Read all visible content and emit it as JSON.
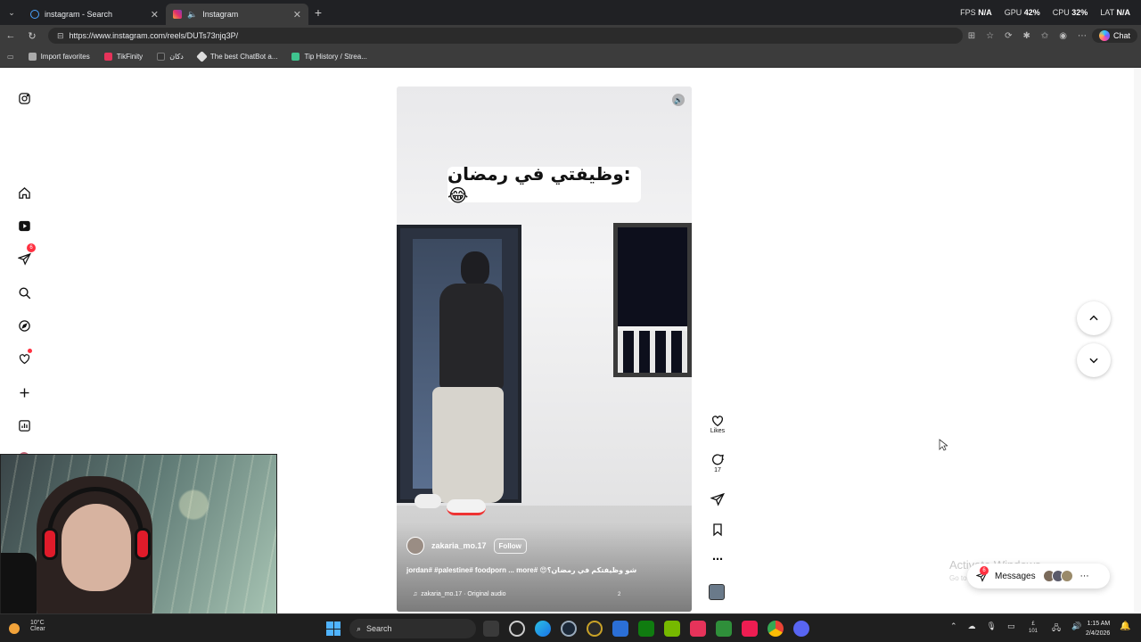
{
  "browser": {
    "tabs": [
      {
        "title": "instagram - Search",
        "active": false,
        "icon": "search-icon"
      },
      {
        "title": "Instagram",
        "active": true,
        "icon": "instagram-icon"
      }
    ],
    "perf": {
      "fps_label": "FPS",
      "fps_value": "N/A",
      "gpu_label": "GPU",
      "gpu_value": "42%",
      "cpu_label": "CPU",
      "cpu_value": "32%",
      "lat_label": "LAT",
      "lat_value": "N/A"
    },
    "url": "https://www.instagram.com/reels/DUTs73njq3P/",
    "chat_label": "Chat",
    "bookmarks": [
      "Import favorites",
      "TikFinity",
      "دكان",
      "The best ChatBot a...",
      "Tip History / Strea..."
    ]
  },
  "sidebar": {
    "notifications_badge": "6"
  },
  "reel": {
    "overlay_text": "وظيفتي في رمضان:😂",
    "author": "zakaria_mo.17",
    "follow_label": "Follow",
    "caption": "شو وظيفتكم في رمضان؟😍 #jordan# #palestine# foodporn ... more",
    "audio": "zakaria_mo.17 · Original audio",
    "audio_num": "2"
  },
  "actions": {
    "likes_label": "Likes",
    "comments_count": "17"
  },
  "activate": {
    "title": "Activate Windows",
    "sub": "Go to Settings to activate Windows."
  },
  "messages": {
    "label": "Messages",
    "badge": "6"
  },
  "taskbar": {
    "temp": "10°C",
    "weather": "Clear",
    "search_placeholder": "Search",
    "tray_num_top": "£",
    "tray_num_bottom": "101",
    "time": "1:15 AM",
    "date": "2/4/2026"
  },
  "colors": {
    "notification_red": "#ff3040",
    "chrome_dark": "#202124",
    "taskbar": "#1f1f1f"
  }
}
